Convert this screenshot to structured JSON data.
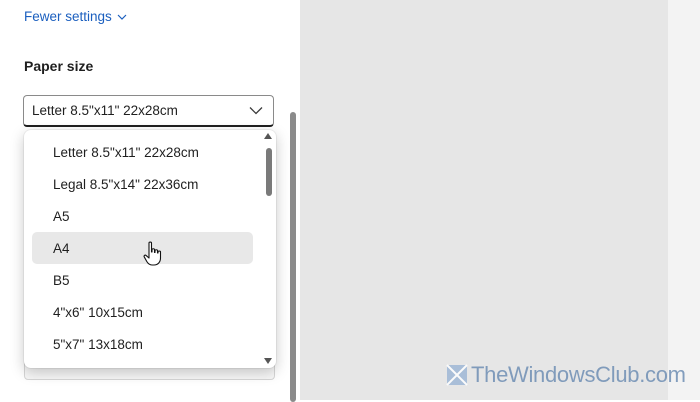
{
  "settings": {
    "fewer_settings_label": "Fewer settings",
    "paper_size_label": "Paper size",
    "paper_size_selected": "Letter 8.5\"x11\" 22x28cm"
  },
  "dropdown": {
    "options": [
      "Letter 8.5\"x11\" 22x28cm",
      "Legal 8.5\"x14\" 22x36cm",
      "A5",
      "A4",
      "B5",
      "4\"x6\" 10x15cm",
      "5\"x7\" 13x18cm"
    ],
    "hovered": "A4"
  },
  "watermark": {
    "text": "TheWindowsClub.com"
  },
  "colors": {
    "link": "#1b5fbf",
    "preview_bg": "#e6e6e6",
    "hover_bg": "#e8e8e8"
  },
  "icons": {
    "fewer_settings": "chevron-up-icon",
    "select": "chevron-down-icon",
    "cursor": "hand-pointer-icon"
  }
}
